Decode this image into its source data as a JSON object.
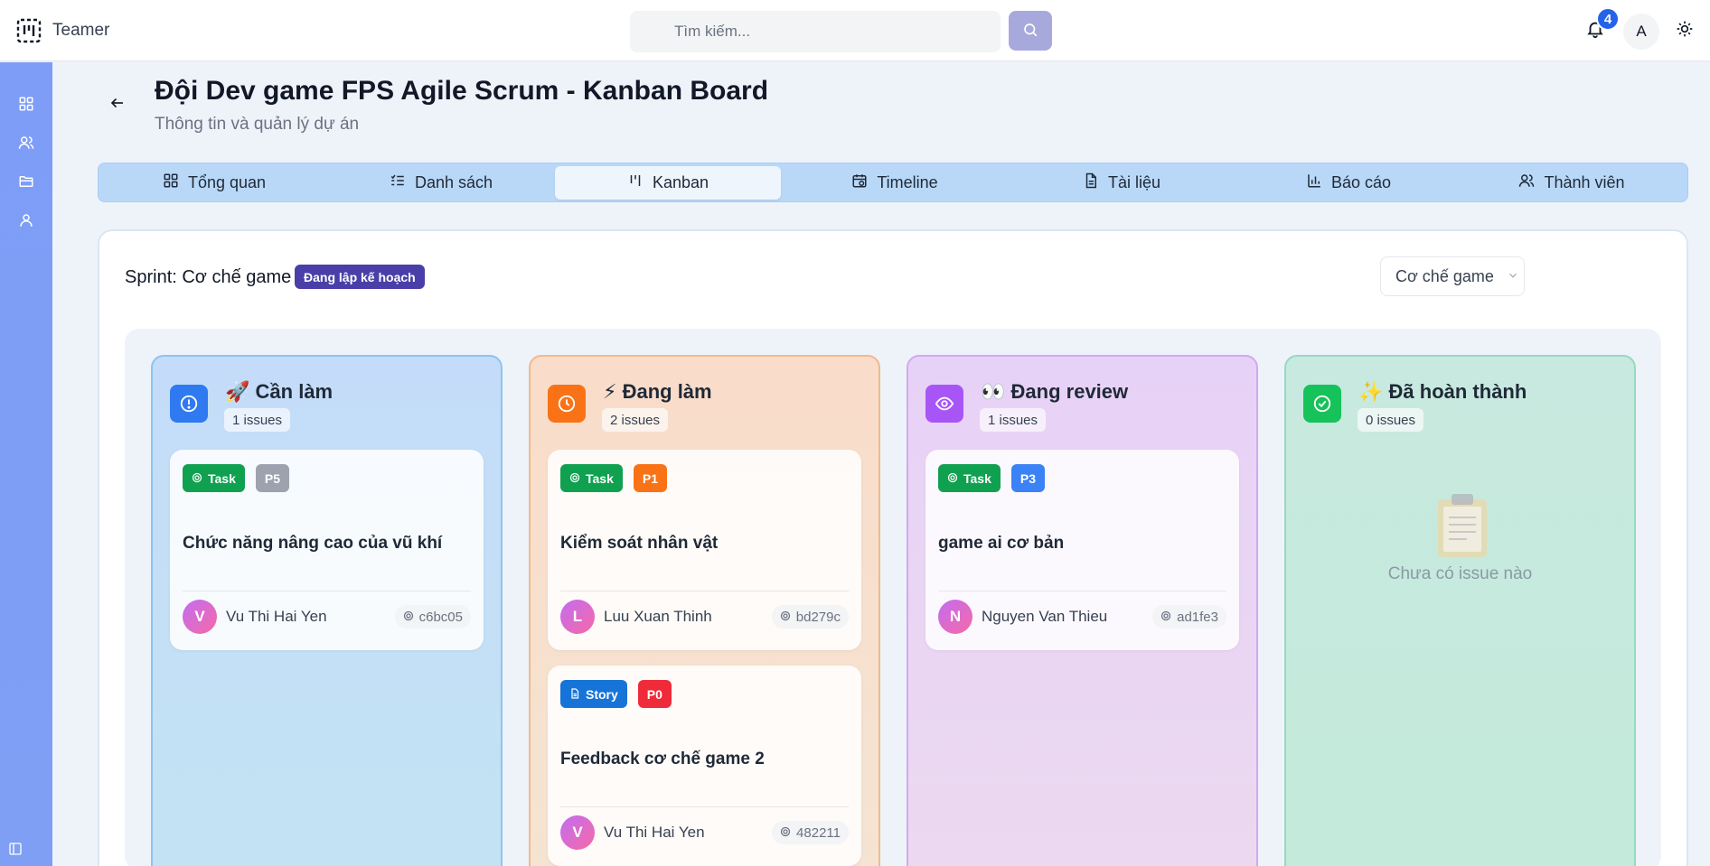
{
  "app": {
    "name": "Teamer"
  },
  "search": {
    "placeholder": "Tìm kiếm..."
  },
  "notifications": {
    "count": "4"
  },
  "user": {
    "initial": "A"
  },
  "sidebar": {
    "items": [
      {
        "icon": "dashboard-icon"
      },
      {
        "icon": "users-icon"
      },
      {
        "icon": "folder-icon"
      },
      {
        "icon": "user-icon"
      }
    ]
  },
  "header": {
    "title": "Đội Dev game FPS Agile Scrum - Kanban Board",
    "subtitle": "Thông tin và quản lý dự án"
  },
  "tabs": [
    {
      "label": "Tổng quan",
      "icon": "grid-icon",
      "active": false
    },
    {
      "label": "Danh sách",
      "icon": "list-icon",
      "active": false
    },
    {
      "label": "Kanban",
      "icon": "kanban-icon",
      "active": true
    },
    {
      "label": "Timeline",
      "icon": "calendar-clock-icon",
      "active": false
    },
    {
      "label": "Tài liệu",
      "icon": "document-icon",
      "active": false
    },
    {
      "label": "Báo cáo",
      "icon": "bar-chart-icon",
      "active": false
    },
    {
      "label": "Thành viên",
      "icon": "members-icon",
      "active": false
    }
  ],
  "sprint": {
    "label": "Sprint: Cơ chế game",
    "status": "Đang lập kế hoạch",
    "selected": "Cơ chế game"
  },
  "columns": [
    {
      "emoji": "🚀",
      "title": "Cần làm",
      "count": "1 issues",
      "icon_color": "#2f7af0",
      "issues": [
        {
          "type": "Task",
          "priority": "P5",
          "priority_color": "#9ca3af",
          "title": "Chức năng nâng cao của vũ khí",
          "assignee_initial": "V",
          "assignee": "Vu Thi Hai Yen",
          "id": "c6bc05"
        }
      ]
    },
    {
      "emoji": "⚡",
      "title": "Đang làm",
      "count": "2 issues",
      "icon_color": "#f97316",
      "issues": [
        {
          "type": "Task",
          "priority": "P1",
          "priority_color": "#f97316",
          "title": "Kiểm soát nhân vật",
          "assignee_initial": "L",
          "assignee": "Luu Xuan Thinh",
          "id": "bd279c"
        },
        {
          "type": "Story",
          "priority": "P0",
          "priority_color": "#ef2b3a",
          "title": "Feedback cơ chế game 2",
          "assignee_initial": "V",
          "assignee": "Vu Thi Hai Yen",
          "id": "482211"
        }
      ]
    },
    {
      "emoji": "👀",
      "title": "Đang review",
      "count": "1 issues",
      "icon_color": "#a855f7",
      "issues": [
        {
          "type": "Task",
          "priority": "P3",
          "priority_color": "#3b82f6",
          "title": "game ai cơ bản",
          "assignee_initial": "N",
          "assignee": "Nguyen Van Thieu",
          "id": "ad1fe3"
        }
      ]
    },
    {
      "emoji": "✨",
      "title": "Đã hoàn thành",
      "count": "0 issues",
      "icon_color": "#16c25a",
      "empty_text": "Chưa có issue nào",
      "issues": []
    }
  ]
}
